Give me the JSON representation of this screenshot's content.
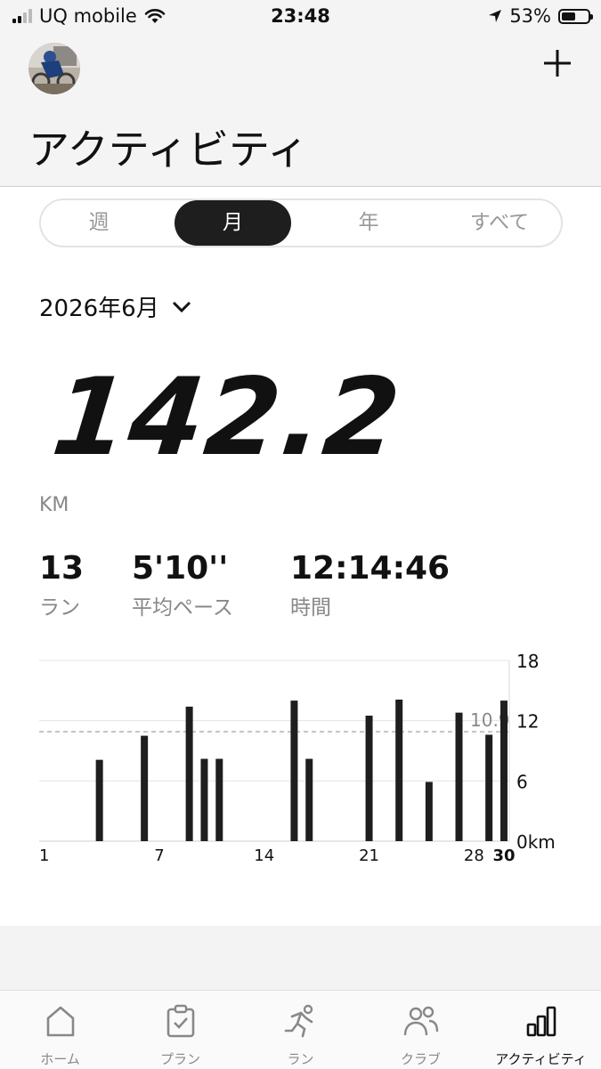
{
  "status": {
    "carrier": "UQ mobile",
    "time": "23:48",
    "battery": "53%",
    "battery_level": 0.53
  },
  "header": {
    "title": "アクティビティ"
  },
  "segments": [
    {
      "label": "週",
      "active": false
    },
    {
      "label": "月",
      "active": true
    },
    {
      "label": "年",
      "active": false
    },
    {
      "label": "すべて",
      "active": false
    }
  ],
  "period": "2026年6月",
  "summary": {
    "distance": "142.2",
    "unit": "KM"
  },
  "stats": [
    {
      "value": "13",
      "label": "ラン"
    },
    {
      "value": "5'10''",
      "label": "平均ペース"
    },
    {
      "value": "12:14:46",
      "label": "時間"
    }
  ],
  "chart_data": {
    "type": "bar",
    "x": [
      3,
      6,
      9,
      10,
      11,
      16,
      17,
      21,
      23,
      25,
      27,
      29,
      30
    ],
    "values": [
      8.1,
      10.5,
      13.4,
      8.2,
      8.2,
      14.0,
      8.2,
      12.5,
      14.1,
      5.9,
      12.8,
      10.6,
      14.0
    ],
    "xlim": [
      1,
      30
    ],
    "ylim": [
      0,
      18
    ],
    "y_ticks": [
      "18",
      "12",
      "6",
      "0km"
    ],
    "x_ticks": [
      "1",
      "7",
      "14",
      "21",
      "28",
      "30"
    ],
    "x_tick_values": [
      1,
      7,
      14,
      21,
      28,
      30
    ],
    "average": 10.9,
    "average_label": "10.9",
    "grid": true
  },
  "tabs": [
    {
      "label": "ホーム",
      "icon": "home-icon",
      "active": false
    },
    {
      "label": "プラン",
      "icon": "clipboard-check-icon",
      "active": false
    },
    {
      "label": "ラン",
      "icon": "runner-icon",
      "active": false
    },
    {
      "label": "クラブ",
      "icon": "people-icon",
      "active": false
    },
    {
      "label": "アクティビティ",
      "icon": "bar-chart-icon",
      "active": true
    }
  ]
}
